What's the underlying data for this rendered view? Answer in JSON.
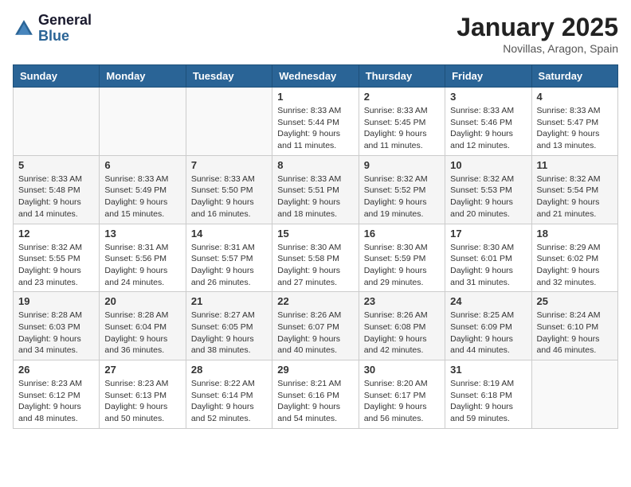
{
  "header": {
    "logo_general": "General",
    "logo_blue": "Blue",
    "month_title": "January 2025",
    "location": "Novillas, Aragon, Spain"
  },
  "days_of_week": [
    "Sunday",
    "Monday",
    "Tuesday",
    "Wednesday",
    "Thursday",
    "Friday",
    "Saturday"
  ],
  "weeks": [
    [
      {
        "day": "",
        "sunrise": "",
        "sunset": "",
        "daylight": ""
      },
      {
        "day": "",
        "sunrise": "",
        "sunset": "",
        "daylight": ""
      },
      {
        "day": "",
        "sunrise": "",
        "sunset": "",
        "daylight": ""
      },
      {
        "day": "1",
        "sunrise": "Sunrise: 8:33 AM",
        "sunset": "Sunset: 5:44 PM",
        "daylight": "Daylight: 9 hours and 11 minutes."
      },
      {
        "day": "2",
        "sunrise": "Sunrise: 8:33 AM",
        "sunset": "Sunset: 5:45 PM",
        "daylight": "Daylight: 9 hours and 11 minutes."
      },
      {
        "day": "3",
        "sunrise": "Sunrise: 8:33 AM",
        "sunset": "Sunset: 5:46 PM",
        "daylight": "Daylight: 9 hours and 12 minutes."
      },
      {
        "day": "4",
        "sunrise": "Sunrise: 8:33 AM",
        "sunset": "Sunset: 5:47 PM",
        "daylight": "Daylight: 9 hours and 13 minutes."
      }
    ],
    [
      {
        "day": "5",
        "sunrise": "Sunrise: 8:33 AM",
        "sunset": "Sunset: 5:48 PM",
        "daylight": "Daylight: 9 hours and 14 minutes."
      },
      {
        "day": "6",
        "sunrise": "Sunrise: 8:33 AM",
        "sunset": "Sunset: 5:49 PM",
        "daylight": "Daylight: 9 hours and 15 minutes."
      },
      {
        "day": "7",
        "sunrise": "Sunrise: 8:33 AM",
        "sunset": "Sunset: 5:50 PM",
        "daylight": "Daylight: 9 hours and 16 minutes."
      },
      {
        "day": "8",
        "sunrise": "Sunrise: 8:33 AM",
        "sunset": "Sunset: 5:51 PM",
        "daylight": "Daylight: 9 hours and 18 minutes."
      },
      {
        "day": "9",
        "sunrise": "Sunrise: 8:32 AM",
        "sunset": "Sunset: 5:52 PM",
        "daylight": "Daylight: 9 hours and 19 minutes."
      },
      {
        "day": "10",
        "sunrise": "Sunrise: 8:32 AM",
        "sunset": "Sunset: 5:53 PM",
        "daylight": "Daylight: 9 hours and 20 minutes."
      },
      {
        "day": "11",
        "sunrise": "Sunrise: 8:32 AM",
        "sunset": "Sunset: 5:54 PM",
        "daylight": "Daylight: 9 hours and 21 minutes."
      }
    ],
    [
      {
        "day": "12",
        "sunrise": "Sunrise: 8:32 AM",
        "sunset": "Sunset: 5:55 PM",
        "daylight": "Daylight: 9 hours and 23 minutes."
      },
      {
        "day": "13",
        "sunrise": "Sunrise: 8:31 AM",
        "sunset": "Sunset: 5:56 PM",
        "daylight": "Daylight: 9 hours and 24 minutes."
      },
      {
        "day": "14",
        "sunrise": "Sunrise: 8:31 AM",
        "sunset": "Sunset: 5:57 PM",
        "daylight": "Daylight: 9 hours and 26 minutes."
      },
      {
        "day": "15",
        "sunrise": "Sunrise: 8:30 AM",
        "sunset": "Sunset: 5:58 PM",
        "daylight": "Daylight: 9 hours and 27 minutes."
      },
      {
        "day": "16",
        "sunrise": "Sunrise: 8:30 AM",
        "sunset": "Sunset: 5:59 PM",
        "daylight": "Daylight: 9 hours and 29 minutes."
      },
      {
        "day": "17",
        "sunrise": "Sunrise: 8:30 AM",
        "sunset": "Sunset: 6:01 PM",
        "daylight": "Daylight: 9 hours and 31 minutes."
      },
      {
        "day": "18",
        "sunrise": "Sunrise: 8:29 AM",
        "sunset": "Sunset: 6:02 PM",
        "daylight": "Daylight: 9 hours and 32 minutes."
      }
    ],
    [
      {
        "day": "19",
        "sunrise": "Sunrise: 8:28 AM",
        "sunset": "Sunset: 6:03 PM",
        "daylight": "Daylight: 9 hours and 34 minutes."
      },
      {
        "day": "20",
        "sunrise": "Sunrise: 8:28 AM",
        "sunset": "Sunset: 6:04 PM",
        "daylight": "Daylight: 9 hours and 36 minutes."
      },
      {
        "day": "21",
        "sunrise": "Sunrise: 8:27 AM",
        "sunset": "Sunset: 6:05 PM",
        "daylight": "Daylight: 9 hours and 38 minutes."
      },
      {
        "day": "22",
        "sunrise": "Sunrise: 8:26 AM",
        "sunset": "Sunset: 6:07 PM",
        "daylight": "Daylight: 9 hours and 40 minutes."
      },
      {
        "day": "23",
        "sunrise": "Sunrise: 8:26 AM",
        "sunset": "Sunset: 6:08 PM",
        "daylight": "Daylight: 9 hours and 42 minutes."
      },
      {
        "day": "24",
        "sunrise": "Sunrise: 8:25 AM",
        "sunset": "Sunset: 6:09 PM",
        "daylight": "Daylight: 9 hours and 44 minutes."
      },
      {
        "day": "25",
        "sunrise": "Sunrise: 8:24 AM",
        "sunset": "Sunset: 6:10 PM",
        "daylight": "Daylight: 9 hours and 46 minutes."
      }
    ],
    [
      {
        "day": "26",
        "sunrise": "Sunrise: 8:23 AM",
        "sunset": "Sunset: 6:12 PM",
        "daylight": "Daylight: 9 hours and 48 minutes."
      },
      {
        "day": "27",
        "sunrise": "Sunrise: 8:23 AM",
        "sunset": "Sunset: 6:13 PM",
        "daylight": "Daylight: 9 hours and 50 minutes."
      },
      {
        "day": "28",
        "sunrise": "Sunrise: 8:22 AM",
        "sunset": "Sunset: 6:14 PM",
        "daylight": "Daylight: 9 hours and 52 minutes."
      },
      {
        "day": "29",
        "sunrise": "Sunrise: 8:21 AM",
        "sunset": "Sunset: 6:16 PM",
        "daylight": "Daylight: 9 hours and 54 minutes."
      },
      {
        "day": "30",
        "sunrise": "Sunrise: 8:20 AM",
        "sunset": "Sunset: 6:17 PM",
        "daylight": "Daylight: 9 hours and 56 minutes."
      },
      {
        "day": "31",
        "sunrise": "Sunrise: 8:19 AM",
        "sunset": "Sunset: 6:18 PM",
        "daylight": "Daylight: 9 hours and 59 minutes."
      },
      {
        "day": "",
        "sunrise": "",
        "sunset": "",
        "daylight": ""
      }
    ]
  ]
}
